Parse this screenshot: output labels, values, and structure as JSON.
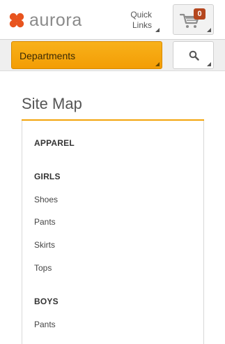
{
  "header": {
    "logo_text": "aurora",
    "logo_color": "#e8541e",
    "quick_links_label_line1": "Quick",
    "quick_links_label_line2": "Links",
    "cart_count": "0",
    "cart_badge_color": "#b5471f"
  },
  "navbar": {
    "departments_label": "Departments",
    "accent_color": "#f5a30a",
    "search_icon": "search-icon"
  },
  "main": {
    "title": "Site Map",
    "sections": [
      {
        "heading": "APPAREL",
        "links": []
      },
      {
        "heading": "GIRLS",
        "links": [
          "Shoes",
          "Pants",
          "Skirts",
          "Tops"
        ]
      },
      {
        "heading": "BOYS",
        "links": [
          "Pants"
        ]
      }
    ]
  }
}
